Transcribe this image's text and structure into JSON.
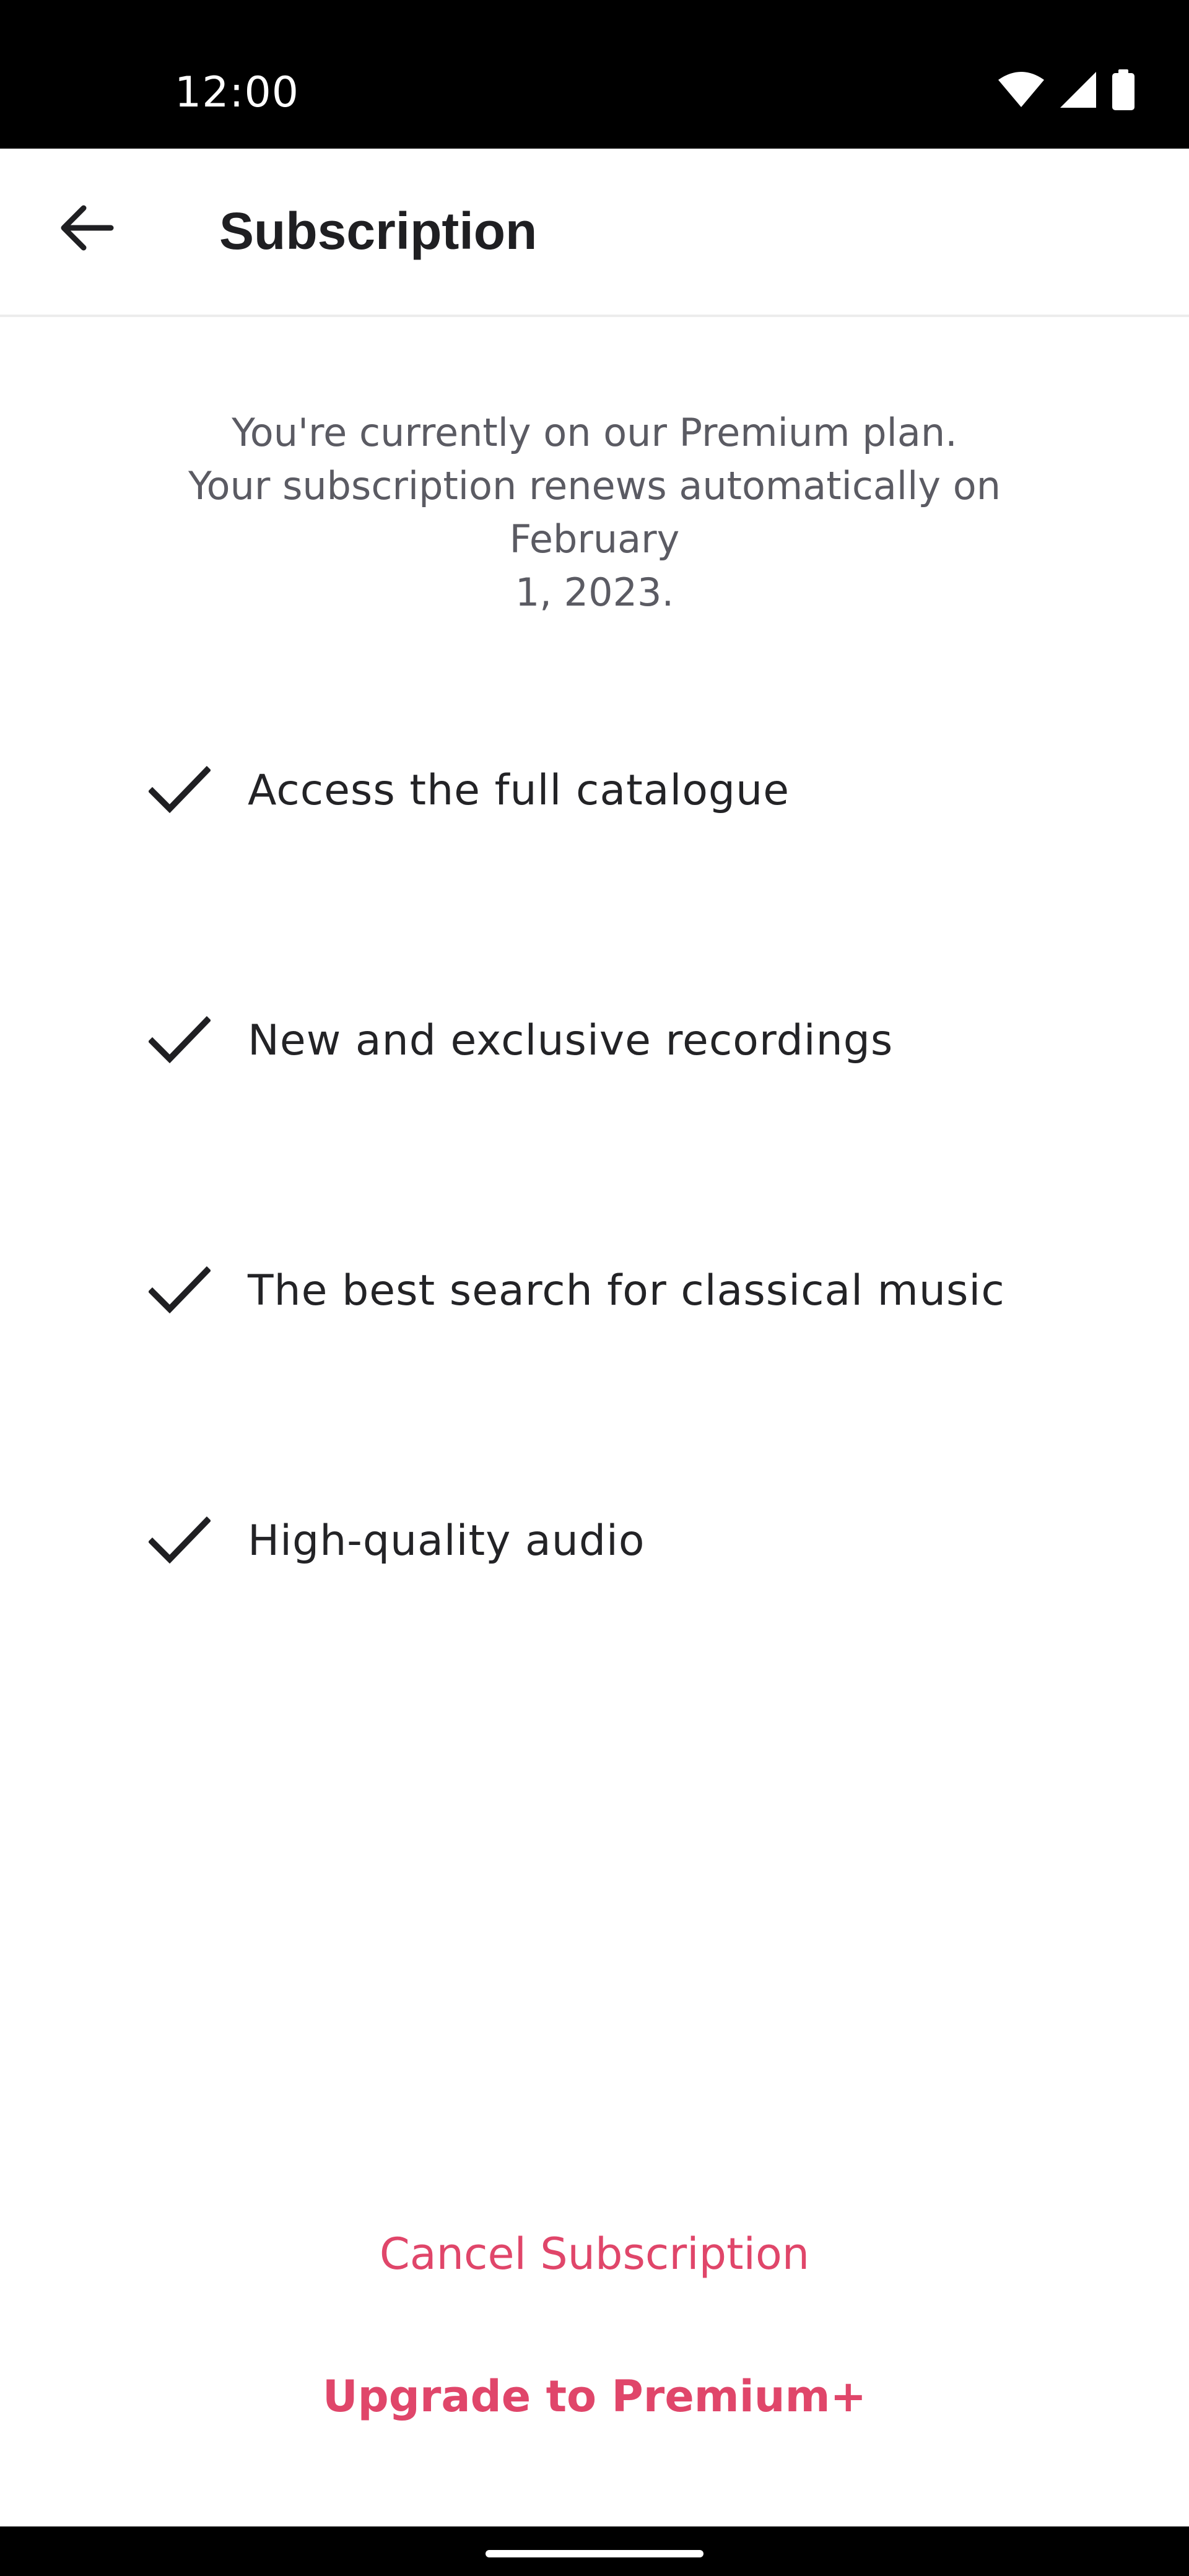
{
  "status_bar": {
    "time": "12:00",
    "icons": [
      "wifi-icon",
      "signal-icon",
      "battery-icon"
    ]
  },
  "app_bar": {
    "back_icon": "arrow-left-icon",
    "title": "Subscription"
  },
  "plan": {
    "line1": "You're currently on our Premium plan.",
    "line2": "Your subscription renews automatically on February",
    "line3": "1, 2023."
  },
  "features": [
    {
      "icon": "check-icon",
      "label": "Access the full catalogue"
    },
    {
      "icon": "check-icon",
      "label": "New and exclusive recordings"
    },
    {
      "icon": "check-icon",
      "label": "The best search for classical music"
    },
    {
      "icon": "check-icon",
      "label": "High-quality audio"
    }
  ],
  "actions": {
    "cancel_label": "Cancel Subscription",
    "upgrade_label": "Upgrade to Premium+"
  },
  "colors": {
    "accent": "#e0466a",
    "text_primary": "#1f1f22",
    "text_secondary": "#5b5b63",
    "status_bar": "#000000"
  }
}
